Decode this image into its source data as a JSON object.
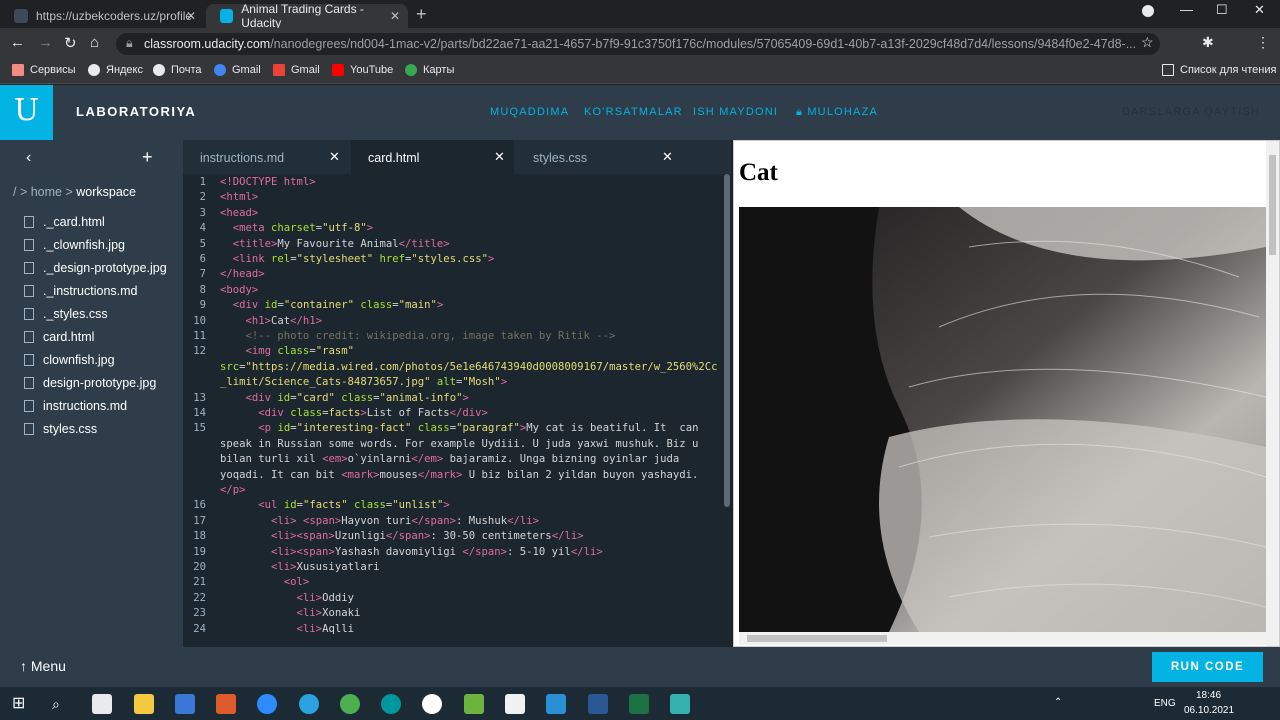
{
  "browser": {
    "tabs": [
      {
        "title": "https://uzbekcoders.uz/profile"
      },
      {
        "title": "Animal Trading Cards - Udacity"
      }
    ],
    "url_host": "classroom.udacity.com",
    "url_path": "/nanodegrees/nd004-1mac-v2/parts/bd22ae71-aa21-4657-b7f9-91c3750f176c/modules/57065409-69d1-40b7-a13f-2029cf48d7d4/lessons/9484f0e2-47d8-...",
    "bookmarks": [
      "Сервисы",
      "Яндекс",
      "Почта",
      "Gmail",
      "Gmail",
      "YouTube",
      "Карты"
    ],
    "reading_list": "Список для чтения"
  },
  "udacity": {
    "title": "LABORATORIYA",
    "nav": [
      "MUQADDIMA",
      "KO'RSATMALAR",
      "ISH MAYDONI",
      "MULOHAZA"
    ],
    "back_label": "DARSLARGA QAYTISH"
  },
  "sidebar": {
    "path_prefix": "/ > home > ",
    "path_current": "workspace",
    "files": [
      "._card.html",
      "._clownfish.jpg",
      "._design-prototype.jpg",
      "._instructions.md",
      "._styles.css",
      "card.html",
      "clownfish.jpg",
      "design-prototype.jpg",
      "instructions.md",
      "styles.css"
    ]
  },
  "editor": {
    "tabs": [
      "instructions.md",
      "card.html",
      "styles.css"
    ],
    "active_tab": "card.html"
  },
  "preview": {
    "heading": "Cat"
  },
  "bottom": {
    "menu": "Menu",
    "run": "RUN CODE"
  },
  "taskbar": {
    "lang": "ENG",
    "time": "18:46",
    "date": "06.10.2021"
  }
}
